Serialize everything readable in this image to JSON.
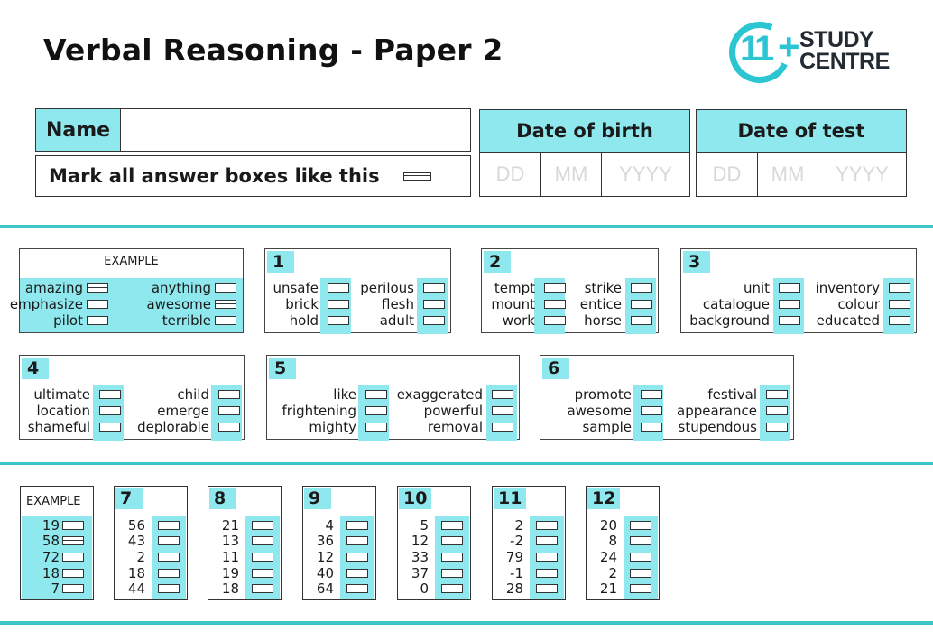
{
  "header": {
    "title": "Verbal Reasoning - Paper 2",
    "logo": {
      "mark": "11+",
      "line1": "STUDY",
      "line2": "CENTRE",
      "color": "#2cc6d2"
    }
  },
  "form": {
    "name_label": "Name",
    "name_value": "",
    "mark_instruction": "Mark all answer boxes like this",
    "date_of_birth": {
      "label": "Date of birth",
      "dd": "DD",
      "mm": "MM",
      "yyyy": "YYYY"
    },
    "date_of_test": {
      "label": "Date of test",
      "dd": "DD",
      "mm": "MM",
      "yyyy": "YYYY"
    }
  },
  "colors": {
    "accent": "#8ee8ee",
    "separator": "#3cc6c9"
  },
  "word_example": {
    "label": "EXAMPLE",
    "left": [
      {
        "word": "amazing",
        "marked": true
      },
      {
        "word": "emphasize",
        "marked": false
      },
      {
        "word": "pilot",
        "marked": false
      }
    ],
    "right": [
      {
        "word": "anything",
        "marked": false
      },
      {
        "word": "awesome",
        "marked": true
      },
      {
        "word": "terrible",
        "marked": false
      }
    ]
  },
  "word_questions": [
    {
      "number": "1",
      "left": [
        "unsafe",
        "brick",
        "hold"
      ],
      "right": [
        "perilous",
        "flesh",
        "adult"
      ]
    },
    {
      "number": "2",
      "left": [
        "tempt",
        "mount",
        "work"
      ],
      "right": [
        "strike",
        "entice",
        "horse"
      ]
    },
    {
      "number": "3",
      "left": [
        "unit",
        "catalogue",
        "background"
      ],
      "right": [
        "inventory",
        "colour",
        "educated"
      ]
    },
    {
      "number": "4",
      "left": [
        "ultimate",
        "location",
        "shameful"
      ],
      "right": [
        "child",
        "emerge",
        "deplorable"
      ]
    },
    {
      "number": "5",
      "left": [
        "like",
        "frightening",
        "mighty"
      ],
      "right": [
        "exaggerated",
        "powerful",
        "removal"
      ]
    },
    {
      "number": "6",
      "left": [
        "promote",
        "awesome",
        "sample"
      ],
      "right": [
        "festival",
        "appearance",
        "stupendous"
      ]
    }
  ],
  "number_example": {
    "label": "EXAMPLE",
    "items": [
      {
        "value": "19",
        "marked": false
      },
      {
        "value": "58",
        "marked": true
      },
      {
        "value": "72",
        "marked": false
      },
      {
        "value": "18",
        "marked": false
      },
      {
        "value": "7",
        "marked": false
      }
    ]
  },
  "number_questions": [
    {
      "number": "7",
      "values": [
        "56",
        "43",
        "2",
        "18",
        "44"
      ]
    },
    {
      "number": "8",
      "values": [
        "21",
        "13",
        "11",
        "19",
        "18"
      ]
    },
    {
      "number": "9",
      "values": [
        "4",
        "36",
        "12",
        "40",
        "64"
      ]
    },
    {
      "number": "10",
      "values": [
        "5",
        "12",
        "33",
        "37",
        "0"
      ]
    },
    {
      "number": "11",
      "values": [
        "2",
        "-2",
        "79",
        "-1",
        "28"
      ]
    },
    {
      "number": "12",
      "values": [
        "20",
        "8",
        "24",
        "2",
        "21"
      ]
    }
  ]
}
